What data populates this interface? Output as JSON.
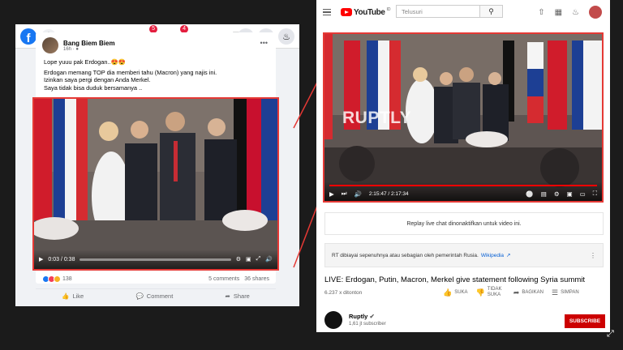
{
  "facebook": {
    "logo": "f",
    "badges": {
      "watch": "5",
      "marketplace": "4"
    },
    "post": {
      "author": "Bang Biem Biem",
      "time": "16h · ",
      "lines": [
        "Lope yuuu pak Erdogan..😍😍",
        "Erdogan memang TOP  dia memberi tahu  (Macron) yang najis ini.",
        "Izinkan saya pergi dengan  Anda Merkel.",
        "Saya tidak bisa duduk bersamanya .."
      ],
      "video_time": "0:03 / 0:38",
      "reactions_count": "138",
      "comments": "5 comments",
      "shares": "36 shares",
      "actions": {
        "like": "Like",
        "comment": "Comment",
        "share": "Share"
      }
    }
  },
  "youtube": {
    "logo_text": "YouTube",
    "country_code": "ID",
    "search_placeholder": "Telusuri",
    "watermark": "RUPTLY",
    "video_time": "2:15:47 / 2:17:34",
    "replay_notice": "Replay live chat dinonaktifkan untuk video ini.",
    "info_notice": "RT dibiayai sepenuhnya atau sebagian oleh pemerintah Rusia.",
    "info_link": "Wikipedia",
    "title": "LIVE: Erdogan, Putin, Macron, Merkel give statement following Syria summit",
    "views": "6.237 x ditonton",
    "actions": {
      "like": "SUKA",
      "dislike": "TIDAK SUKA",
      "share": "BAGIKAN",
      "save": "SIMPAN"
    },
    "channel": "Ruptly",
    "subscribers": "1,61 jt subscriber",
    "subscribe_label": "SUBSCRIBE"
  },
  "colors": {
    "highlight": "#e53935",
    "facebook_blue": "#1877f2",
    "youtube_red": "#ff0000"
  }
}
